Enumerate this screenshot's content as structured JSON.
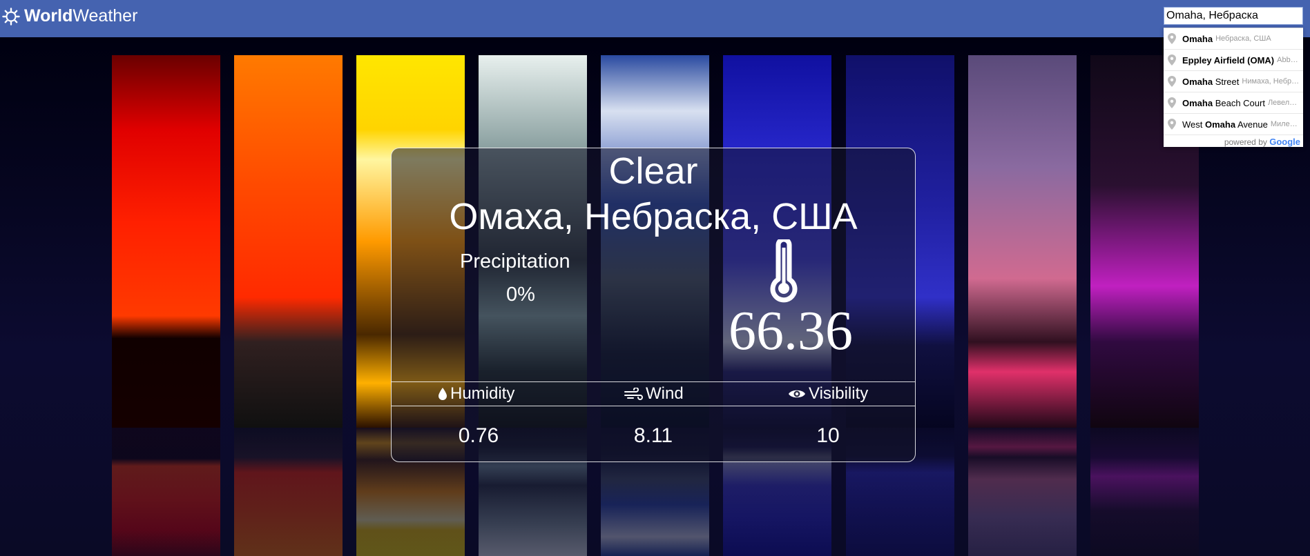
{
  "navbar": {
    "brand_bold": "World",
    "brand_regular": "Weather",
    "brand_icon": "sun-icon",
    "search_value": "Omaha, Небраска"
  },
  "autocomplete": {
    "items": [
      {
        "main_bold": "Omaha",
        "main_rest": "",
        "secondary": "Небраска, США"
      },
      {
        "main_bold": "Eppley Airfield (OMA)",
        "main_rest": "",
        "secondary": "Abb…"
      },
      {
        "main_bold": "Omaha",
        "main_rest": " Street",
        "secondary": "Нимаха, Небр…"
      },
      {
        "main_bold": "Omaha",
        "main_rest": " Beach Court",
        "secondary": "Левел…"
      },
      {
        "main_prefix": "West ",
        "main_bold": "Omaha",
        "main_rest": " Avenue",
        "secondary": "Миле…"
      }
    ],
    "footer_text": "powered by",
    "footer_brand": "Google",
    "pin_icon": "map-pin-icon"
  },
  "weather": {
    "summary": "Clear",
    "location": "Омаха, Небраска, США",
    "precipitation_label": "Precipitation",
    "precipitation_value": "0%",
    "temperature": "66.36",
    "thermometer_icon": "thermometer-icon",
    "metrics": {
      "humidity_label": "Humidity",
      "wind_label": "Wind",
      "visibility_label": "Visibility",
      "humidity_value": "0.76",
      "wind_value": "8.11",
      "visibility_value": "10"
    }
  }
}
